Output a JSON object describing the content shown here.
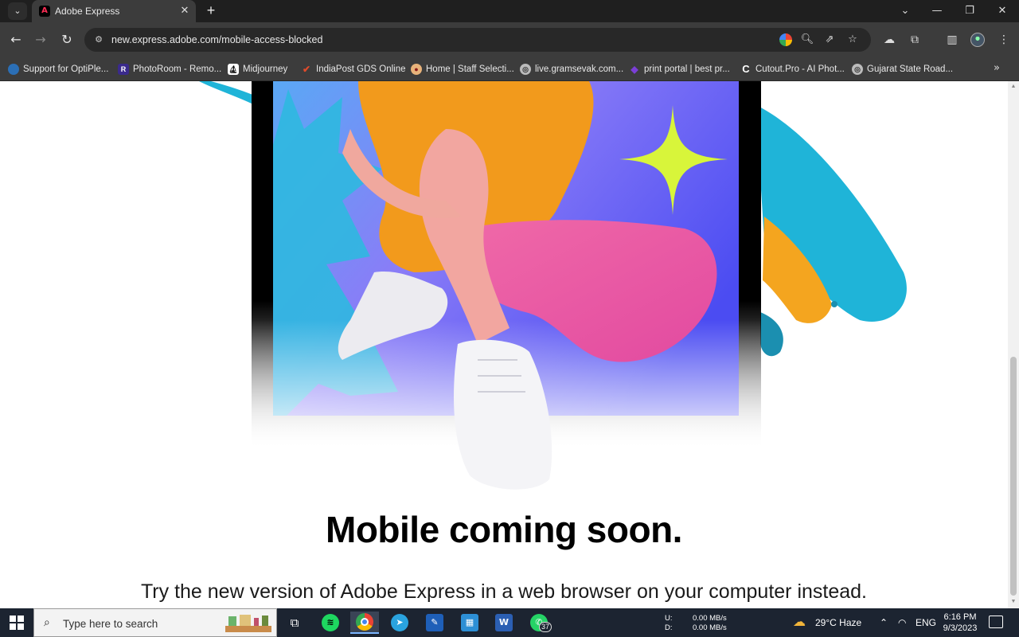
{
  "browser": {
    "tab_title": "Adobe Express",
    "tab_close": "✕",
    "new_tab": "+",
    "url": "new.express.adobe.com/mobile-access-blocked",
    "window_minimize": "—",
    "window_restore": "❐",
    "window_close": "✕"
  },
  "bookmarks": [
    {
      "label": "Support for OptiPle...",
      "icon": "dell-icon",
      "color": "#2b6fb6"
    },
    {
      "label": "PhotoRoom - Remo...",
      "icon": "photoroom-icon",
      "color": "#3a2a8c"
    },
    {
      "label": "Midjourney",
      "icon": "midjourney-icon",
      "color": "#ffffff"
    },
    {
      "label": "IndiaPost GDS Online",
      "icon": "indiapost-icon",
      "color": "#d9342b"
    },
    {
      "label": "Home | Staff Selecti...",
      "icon": "ssc-icon",
      "color": "#c0392b"
    },
    {
      "label": "live.gramsevak.com...",
      "icon": "globe-icon",
      "color": "#888888"
    },
    {
      "label": "print portal | best pr...",
      "icon": "print-portal-icon",
      "color": "#6b2fb3"
    },
    {
      "label": "Cutout.Pro - AI Phot...",
      "icon": "cutout-icon",
      "color": "#ffffff"
    },
    {
      "label": "Gujarat State Road...",
      "icon": "globe-icon",
      "color": "#888888"
    }
  ],
  "page": {
    "headline": "Mobile coming soon.",
    "subline": "Try the new version of Adobe Express in a web browser on your computer instead."
  },
  "taskbar": {
    "search_placeholder": "Type here to search",
    "whatsapp_badge": "37",
    "net_up_label": "U:",
    "net_up_value": "0.00 MB/s",
    "net_down_label": "D:",
    "net_down_value": "0.00 MB/s",
    "weather": "29°C  Haze",
    "language": "ENG",
    "time": "6:16 PM",
    "date": "9/3/2023"
  },
  "colors": {
    "browser_bg": "#3c3c3c",
    "taskbar_bg": "#1c2431",
    "hero_purple": "#8a7cf7",
    "hero_blue": "#3ea0f0",
    "paint_cyan": "#1fb4d8",
    "paint_orange": "#f4a51f",
    "sparkle_lime": "#d8f53a"
  }
}
